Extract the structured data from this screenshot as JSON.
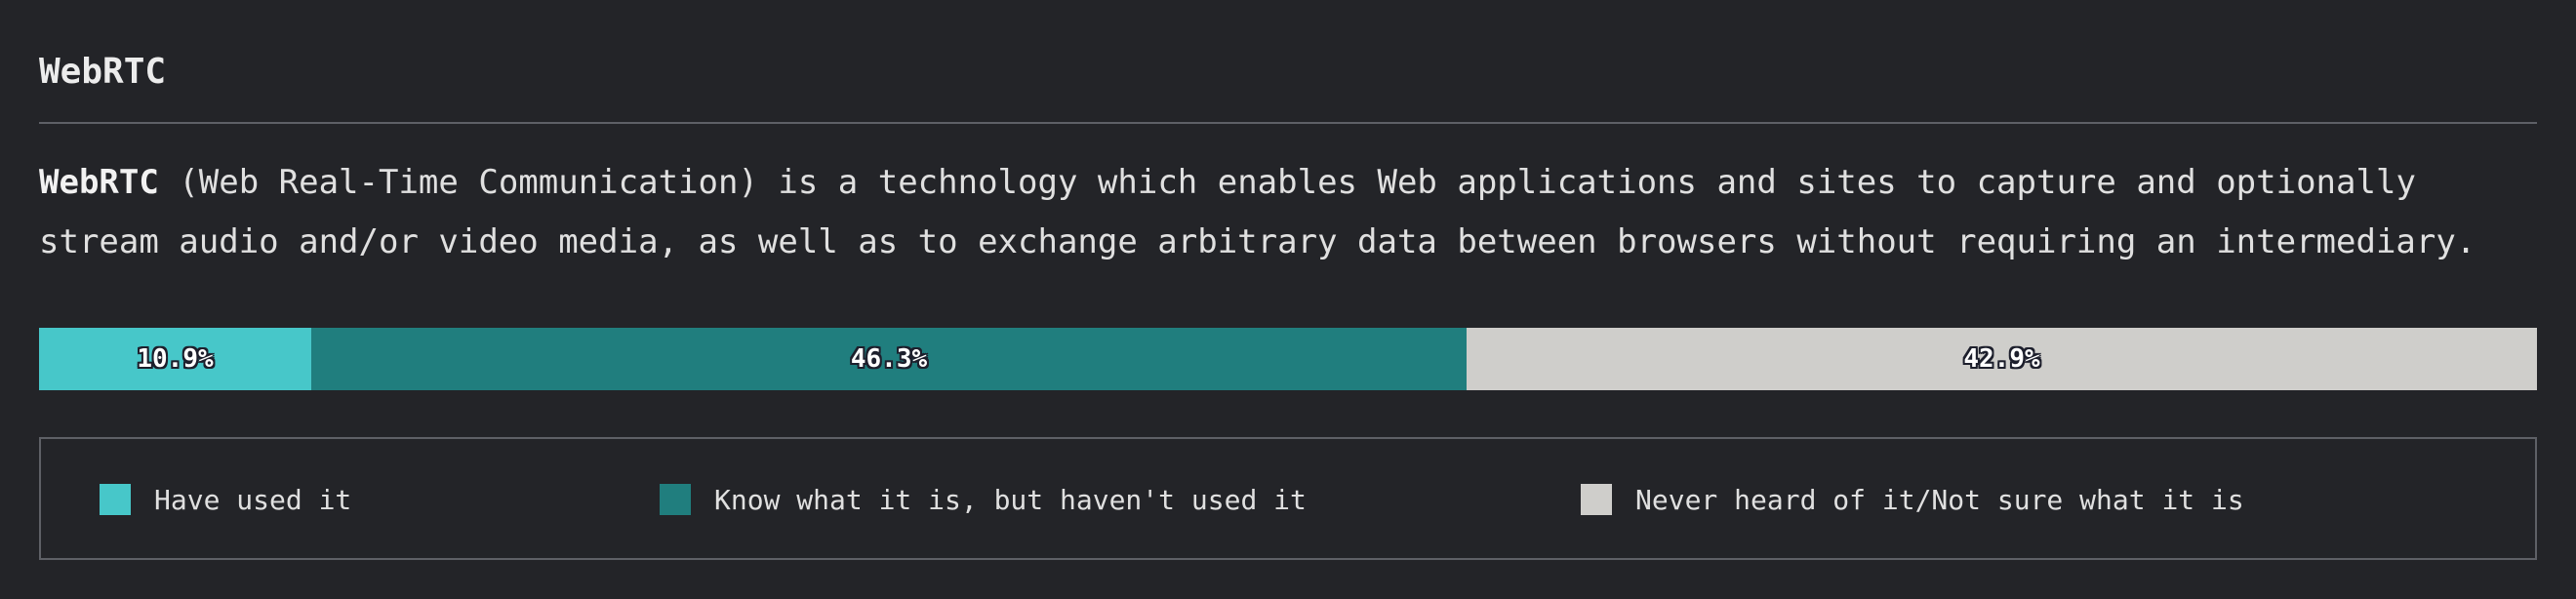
{
  "heading": "WebRTC",
  "description": {
    "term": "WebRTC",
    "line1": " (Web Real-Time Communication) is a technology which enables Web applications and sites to capture and optionally",
    "line2": "stream audio and/or video media, as well as to exchange arbitrary data between browsers without requiring an intermediary."
  },
  "chart_data": {
    "type": "bar",
    "orientation": "horizontal-stacked",
    "categories": [
      "WebRTC"
    ],
    "series": [
      {
        "name": "Have used it",
        "values": [
          10.9
        ],
        "label": "10.9%",
        "color": "#47c7c9"
      },
      {
        "name": "Know what it is, but haven't used it",
        "values": [
          46.3
        ],
        "label": "46.3%",
        "color": "#207e7e"
      },
      {
        "name": "Never heard of it/Not sure what it is",
        "values": [
          42.9
        ],
        "label": "42.9%",
        "color": "#cfcecb"
      }
    ],
    "unit": "%",
    "legend_position": "bottom"
  }
}
